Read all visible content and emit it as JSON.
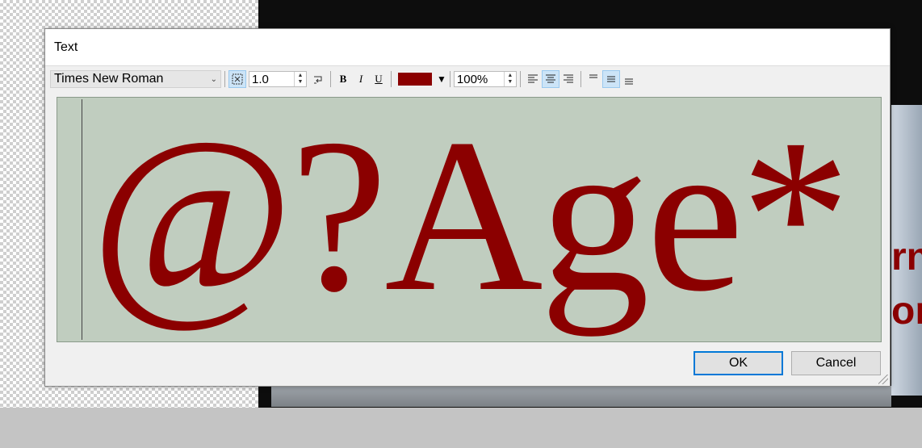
{
  "dialog": {
    "title": "Text",
    "ok_label": "OK",
    "cancel_label": "Cancel"
  },
  "toolbar": {
    "font_family": "Times New Roman",
    "line_spacing": "1.0",
    "bold_label": "B",
    "italic_label": "I",
    "underline_label": "U",
    "text_color": "#8b0000",
    "zoom": "100%",
    "icons": [
      "fit-frame-icon",
      "wrap-icon",
      "align-left-icon",
      "align-center-icon",
      "align-right-icon",
      "valign-top-icon",
      "valign-middle-icon",
      "valign-bottom-icon"
    ]
  },
  "editor": {
    "content": "@?Age*",
    "background_color": "#c0cdbf"
  },
  "background": {
    "partial_text_right": [
      "rn",
      "or"
    ]
  }
}
